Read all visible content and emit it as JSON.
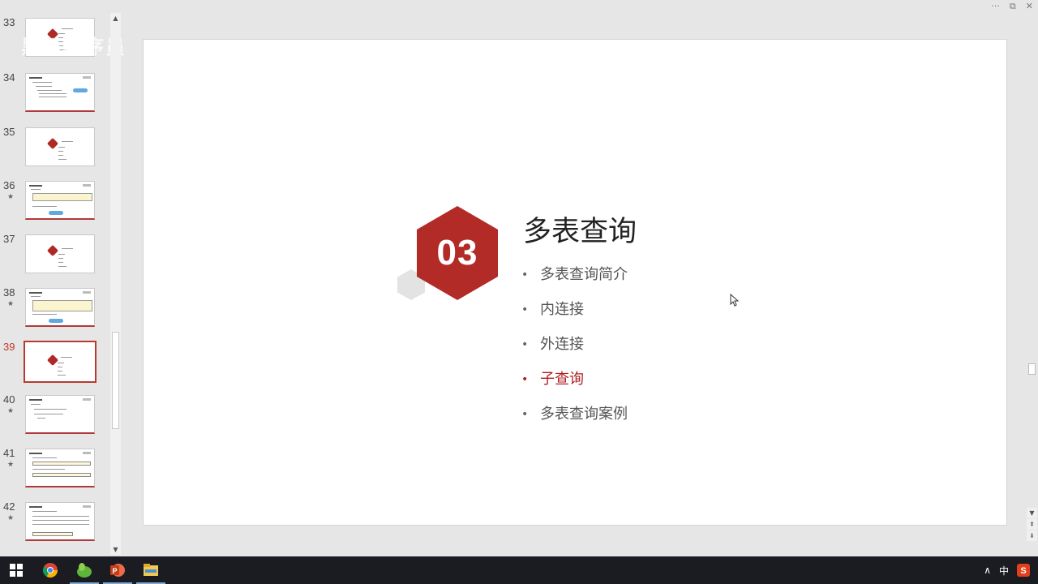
{
  "watermark": "黑马程序员",
  "slide_panel": {
    "items": [
      {
        "number": "33",
        "star": "",
        "active": false
      },
      {
        "number": "34",
        "star": "",
        "active": false
      },
      {
        "number": "35",
        "star": "",
        "active": false
      },
      {
        "number": "36",
        "star": "★",
        "active": false
      },
      {
        "number": "37",
        "star": "",
        "active": false
      },
      {
        "number": "38",
        "star": "★",
        "active": false
      },
      {
        "number": "39",
        "star": "",
        "active": true
      },
      {
        "number": "40",
        "star": "★",
        "active": false
      },
      {
        "number": "41",
        "star": "★",
        "active": false
      },
      {
        "number": "42",
        "star": "★",
        "active": false
      }
    ]
  },
  "slide": {
    "section_number": "03",
    "title": "多表查询",
    "bullets": [
      {
        "text": "多表查询简介",
        "highlight": false
      },
      {
        "text": "内连接",
        "highlight": false
      },
      {
        "text": "外连接",
        "highlight": false
      },
      {
        "text": "子查询",
        "highlight": true
      },
      {
        "text": "多表查询案例",
        "highlight": false
      }
    ],
    "bullet_glyph": "•",
    "highlight_color": "#b01f1f",
    "accent_color": "#b22b27"
  },
  "window_controls": {
    "more": "···",
    "restore": "⧉",
    "close": "✕"
  },
  "taskbar": {
    "ime": "中",
    "tray_chevron": "∧",
    "apps": [
      "windows-start-icon",
      "chrome-icon",
      "feishu-app-icon",
      "powerpoint-icon",
      "file-explorer-icon"
    ]
  }
}
